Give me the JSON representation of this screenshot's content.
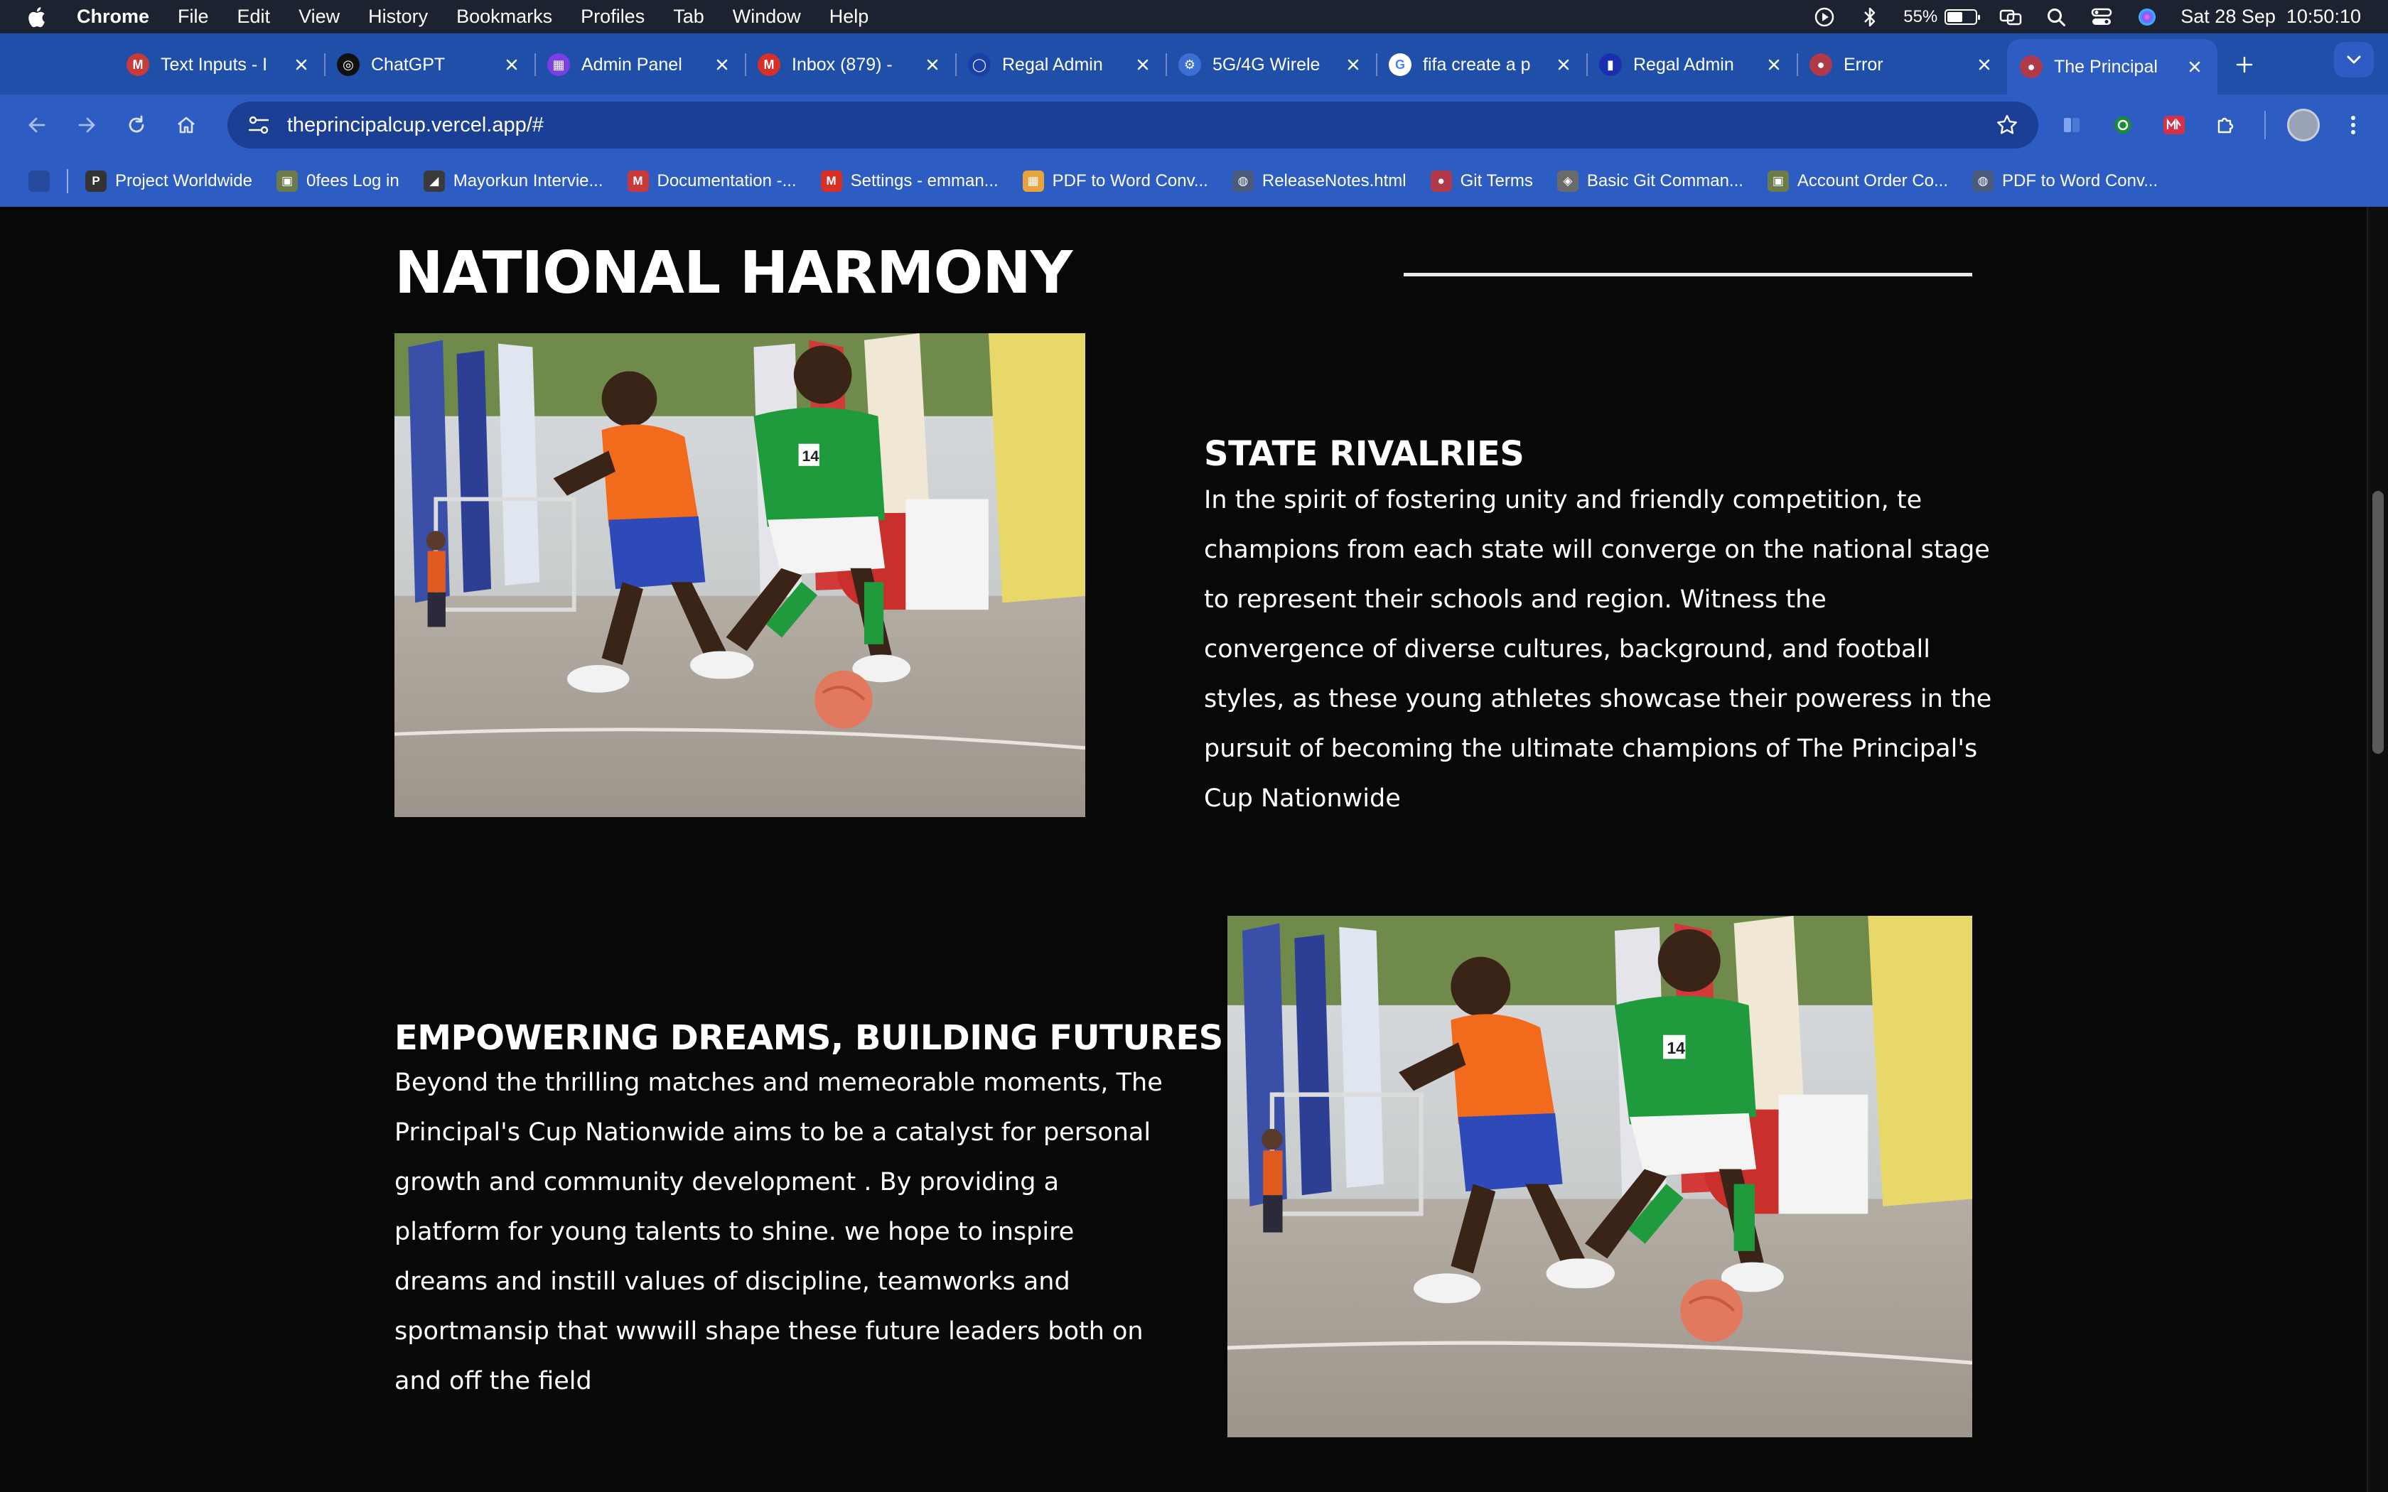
{
  "menubar": {
    "app_name": "Chrome",
    "menus": [
      "File",
      "Edit",
      "View",
      "History",
      "Bookmarks",
      "Profiles",
      "Tab",
      "Window",
      "Help"
    ],
    "battery_percent": "55%",
    "battery_level": 0.55,
    "datetime": "Sat 28 Sep  10:50:10"
  },
  "tabs": [
    {
      "title": "Text Inputs - I",
      "favicon": "M",
      "color": "#c93a3a"
    },
    {
      "title": "ChatGPT",
      "favicon": "◎",
      "color": "#111111"
    },
    {
      "title": "Admin Panel",
      "favicon": "▦",
      "color": "#7b3fe4"
    },
    {
      "title": "Inbox (879) -",
      "favicon": "M",
      "color": "#d93025"
    },
    {
      "title": "Regal Admin",
      "favicon": "◯",
      "color": "#1a3fa6"
    },
    {
      "title": "5G/4G Wirele",
      "favicon": "⚙",
      "color": "#3b6fd4"
    },
    {
      "title": "fifa create a p",
      "favicon": "G",
      "color": "#ffffff"
    },
    {
      "title": "Regal Admin",
      "favicon": "▮",
      "color": "#1a2fb0"
    },
    {
      "title": "Error",
      "favicon": "●",
      "color": "#b03a4a"
    },
    {
      "title": "The Principal",
      "favicon": "●",
      "color": "#b03a4a",
      "active": true
    }
  ],
  "toolbar": {
    "url": "theprincipalcup.vercel.app/#"
  },
  "bookmarks": [
    {
      "label": "Project Worldwide",
      "icon": "P",
      "color": "#333333"
    },
    {
      "label": "0fees Log in",
      "icon": "▣",
      "color": "#6b7b4a"
    },
    {
      "label": "Mayorkun Intervie...",
      "icon": "◢",
      "color": "#3a3a3a"
    },
    {
      "label": "Documentation -...",
      "icon": "M",
      "color": "#c93a3a"
    },
    {
      "label": "Settings - emman...",
      "icon": "M",
      "color": "#d93025"
    },
    {
      "label": "PDF to Word Conv...",
      "icon": "▦",
      "color": "#e8a33d"
    },
    {
      "label": "ReleaseNotes.html",
      "icon": "◍",
      "color": "#4a5a7a"
    },
    {
      "label": "Git Terms",
      "icon": "●",
      "color": "#b03a4a"
    },
    {
      "label": "Basic Git Comman...",
      "icon": "◈",
      "color": "#6a6a6a"
    },
    {
      "label": "Account Order Co...",
      "icon": "▣",
      "color": "#6b7b4a"
    },
    {
      "label": "PDF to Word Conv...",
      "icon": "◍",
      "color": "#4a5a7a"
    }
  ],
  "content": {
    "section_title": "NATIONAL HARMONY",
    "rivalries": {
      "heading": "STATE RIVALRIES",
      "text": "In the spirit of fostering unity and friendly competition, te champions from each state will converge on the national stage to represent their schools and region. Witness the convergence of diverse cultures, background, and football styles, as these young athletes showcase their poweress in the pursuit of becoming the ultimate champions of The Principal's Cup Nationwide"
    },
    "empowering": {
      "heading": "EMPOWERING DREAMS, BUILDING FUTURES",
      "text": "Beyond the thrilling matches and memeorable moments, The Principal's Cup Nationwide aims to be a catalyst for personal growth and community development . By providing a platform for young talents to shine. we hope to inspire dreams and instill values of discipline, teamworks and sportmansip that wwwill shape these future leaders both on and off the field"
    },
    "photo_player_number": "14"
  },
  "colors": {
    "menubar_bg": "#1c2230",
    "browser_chrome": "#2d5cc2",
    "page_bg": "#080808",
    "text": "#ffffff"
  }
}
